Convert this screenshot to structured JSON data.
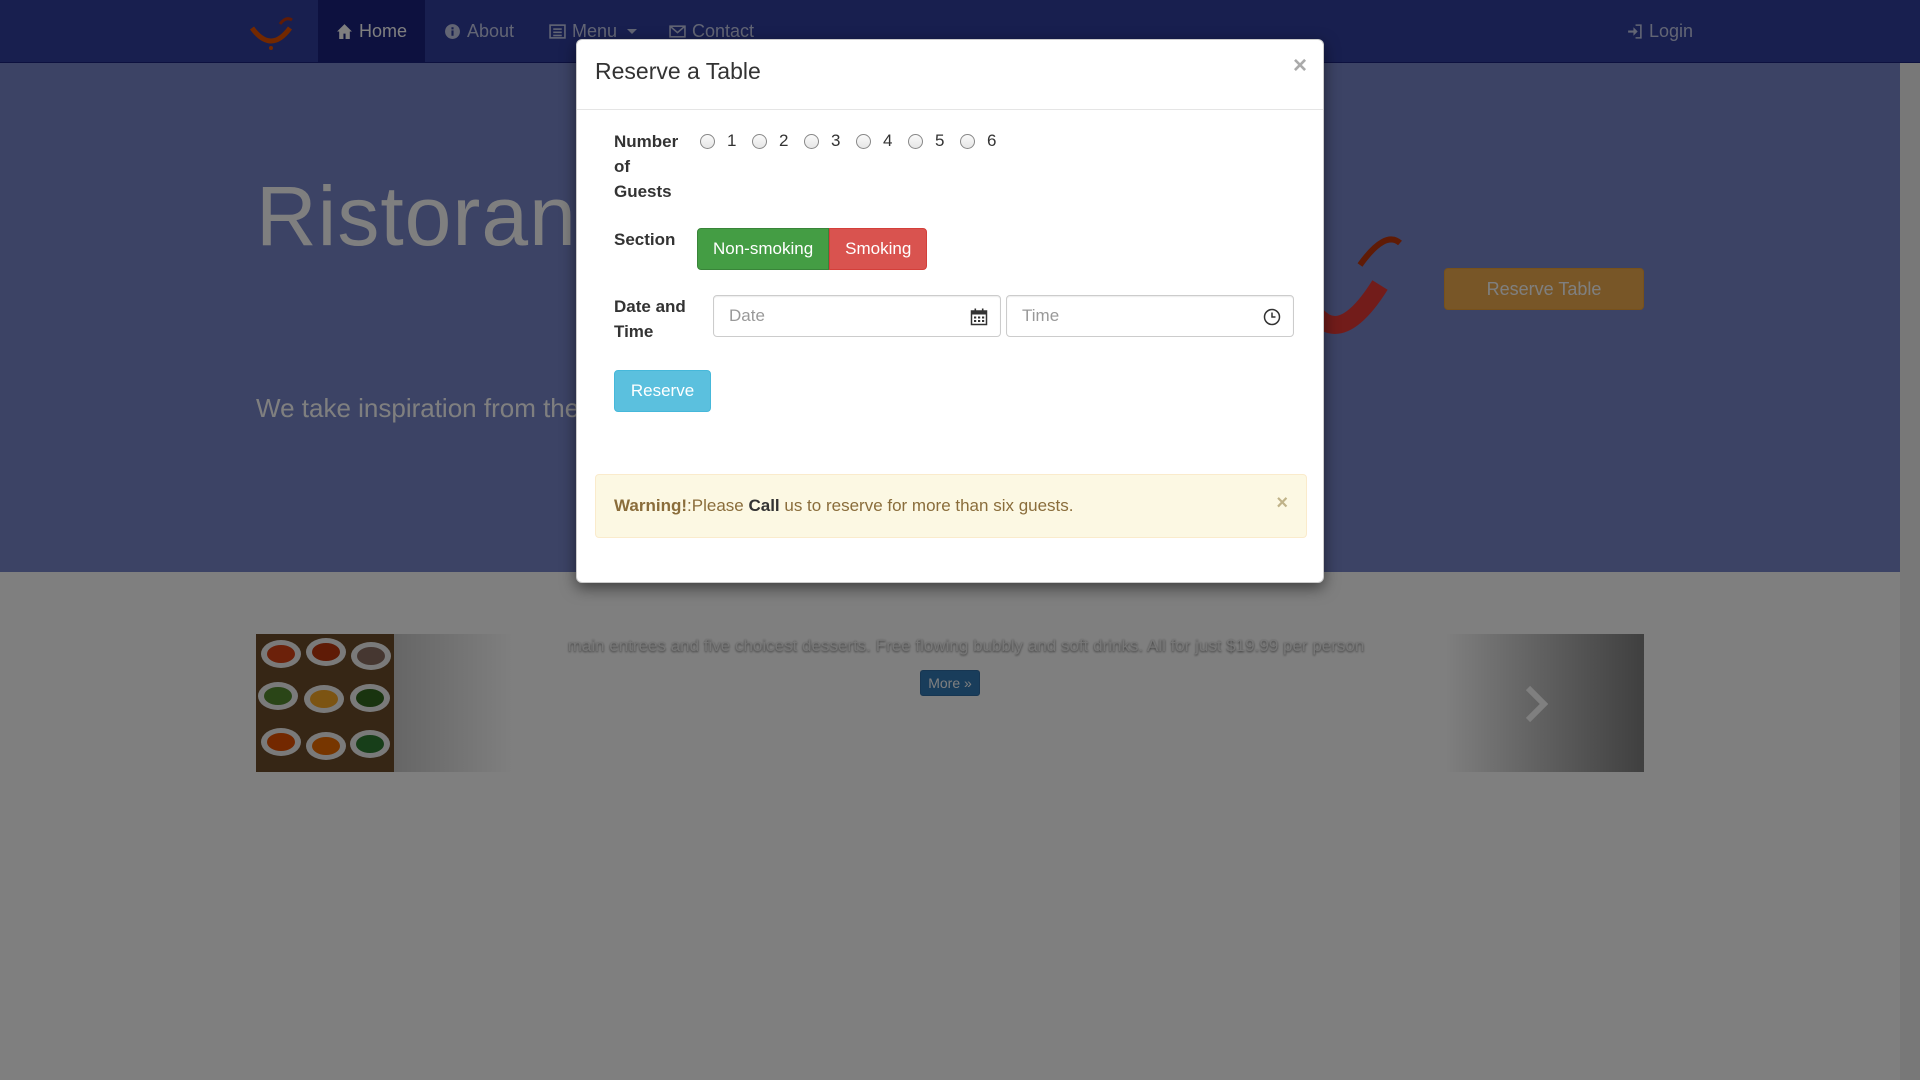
{
  "navbar": {
    "items": [
      {
        "label": "Home",
        "icon": "home-icon",
        "active": true
      },
      {
        "label": "About",
        "icon": "info-icon"
      },
      {
        "label": "Menu",
        "icon": "list-icon"
      },
      {
        "label": "Contact",
        "icon": "envelope-icon"
      }
    ],
    "login_label": "Login"
  },
  "hero": {
    "title": "Ristorante con Fusion",
    "text": "We take inspiration from the World's best cuisines, and create a unique fusion experience. Our lipsmacking creations will tickle your culinary senses!",
    "reserve_table_label": "Reserve Table"
  },
  "carousel": {
    "caption": "main entrees and five choicest desserts. Free flowing bubbly and soft drinks. All for just $19.99 per person",
    "more_label": "More »"
  },
  "modal": {
    "title": "Reserve a Table",
    "close_symbol": "×",
    "guests_label": "Number of Guests",
    "guest_options": [
      "1",
      "2",
      "3",
      "4",
      "5",
      "6"
    ],
    "section_label": "Section",
    "section_options": [
      "Non-smoking",
      "Smoking"
    ],
    "datetime_label": "Date and Time",
    "date_placeholder": "Date",
    "time_placeholder": "Time",
    "reserve_label": "Reserve",
    "alert": {
      "strong": "Warning!",
      "text_before": ":Please ",
      "call": "Call",
      "text_after": " us to reserve for more than six guests.",
      "close_symbol": "×"
    }
  },
  "colors": {
    "navbar": "#303f9f",
    "jumbotron": "#7986cb",
    "nonsmoking": "#449d44",
    "smoking": "#d9534f",
    "reserve": "#5bc0de",
    "reserve_table": "#f0ad4e",
    "alert_bg": "#fcf8e3"
  }
}
